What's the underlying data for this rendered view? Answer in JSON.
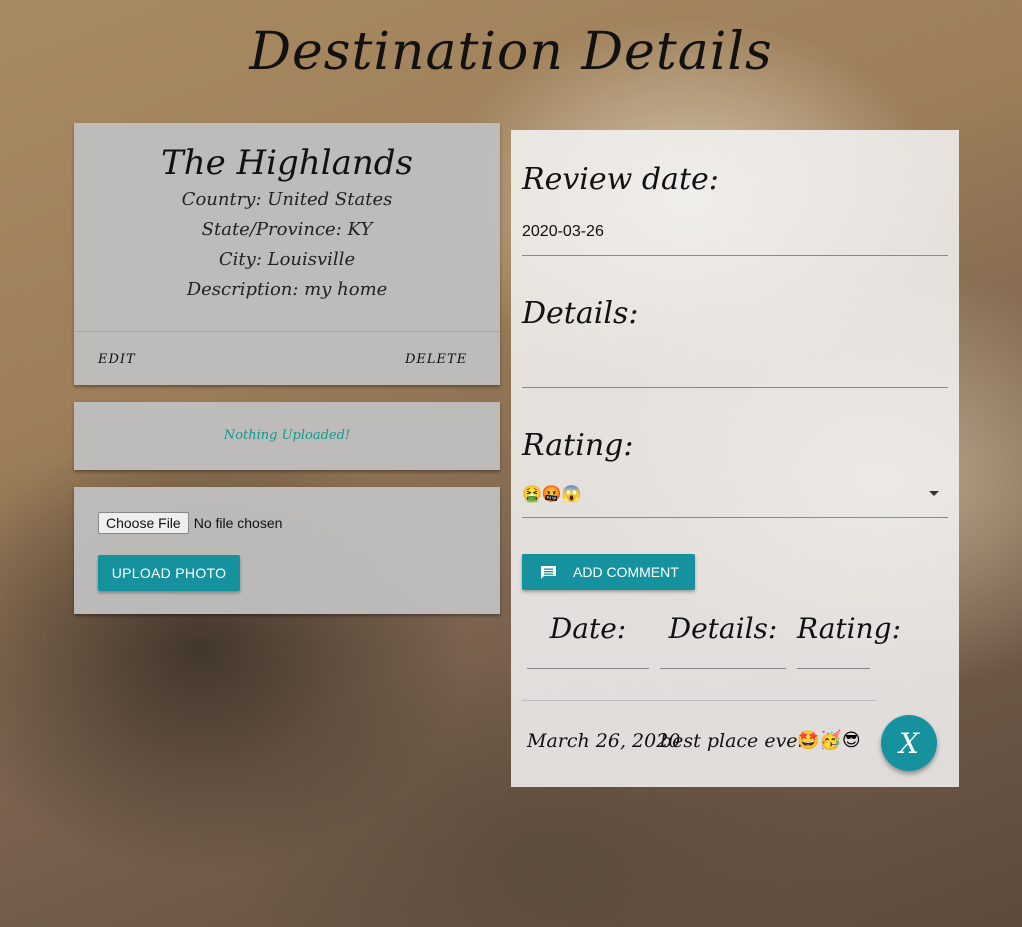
{
  "page_title": "Destination Details",
  "destination": {
    "name": "The Highlands",
    "country": "Country: United States",
    "state": "State/Province: KY",
    "city": "City: Louisville",
    "description": "Description: my home",
    "edit_label": "EDIT",
    "delete_label": "DELETE"
  },
  "photos": {
    "empty_message": "Nothing Uploaded!"
  },
  "upload": {
    "choose_file_label": "Choose File",
    "file_status": "No file chosen",
    "upload_button": "UPLOAD PHOTO"
  },
  "review": {
    "date_label": "Review date:",
    "date_value": "2020-03-26",
    "details_label": "Details:",
    "details_value": "",
    "rating_label": "Rating:",
    "rating_value": "🤮🤬😱",
    "add_comment_button": "ADD COMMENT",
    "add_comment_icon": "comment-icon"
  },
  "comments_table": {
    "headers": [
      "Date:",
      "Details:",
      "Rating:"
    ],
    "rows": [
      {
        "date": "March 26, 2020",
        "details": "best place ever",
        "rating": "🤩🥳😎"
      }
    ],
    "close_button": "X"
  },
  "colors": {
    "accent": "#16929f",
    "notice": "#13978f"
  }
}
